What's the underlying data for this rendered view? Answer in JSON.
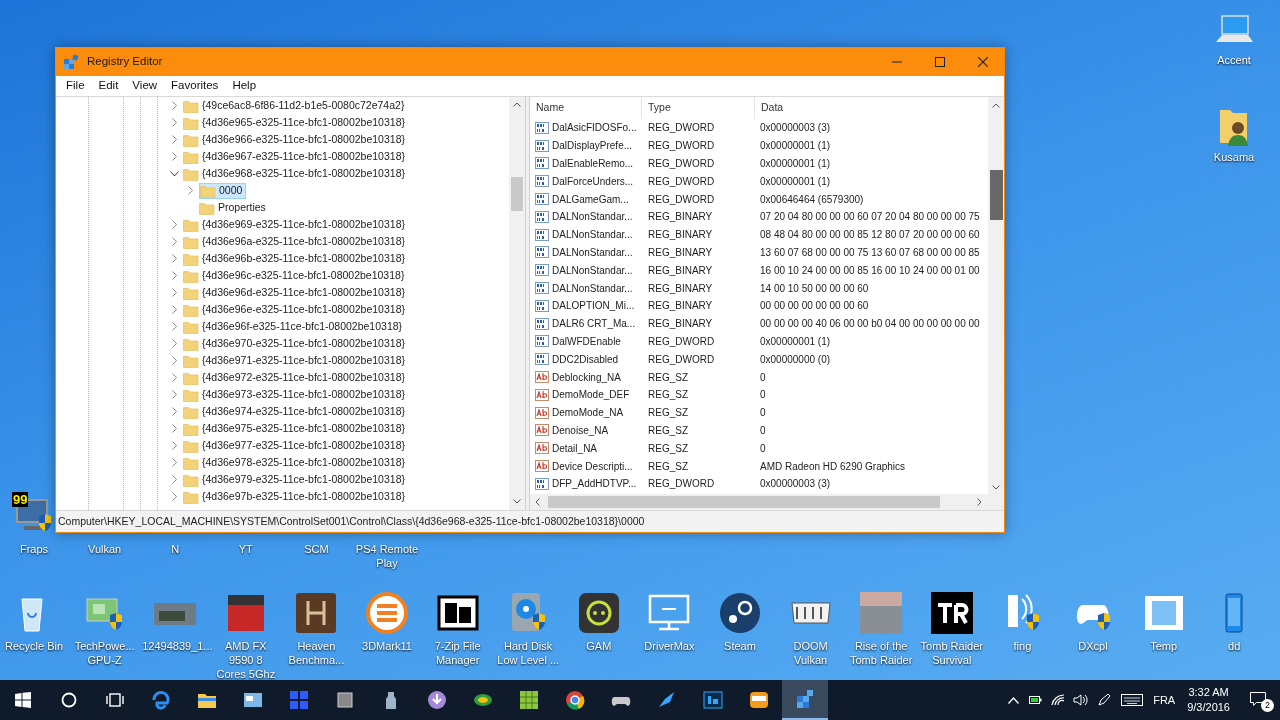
{
  "desktop": {
    "top_right": [
      {
        "label": "Accent"
      },
      {
        "label": "Kusama"
      }
    ],
    "fps_counter": "99",
    "top_row": [
      {
        "label": "Fraps"
      },
      {
        "label": "Vulkan"
      },
      {
        "label": "N"
      },
      {
        "label": "YT"
      },
      {
        "label": "SCM"
      },
      {
        "label": "PS4 Remote Play"
      }
    ],
    "bottom_row": [
      {
        "label": "Recycle Bin"
      },
      {
        "label": "TechPowe... GPU-Z"
      },
      {
        "label": "12494839_1..."
      },
      {
        "label": "AMD FX 9590 8 Cores 5Ghz"
      },
      {
        "label": "Heaven Benchma..."
      },
      {
        "label": "3DMark11"
      },
      {
        "label": "7-Zip File Manager"
      },
      {
        "label": "Hard Disk Low Level ..."
      },
      {
        "label": "GAM"
      },
      {
        "label": "DriverMax"
      },
      {
        "label": "Steam"
      },
      {
        "label": "DOOM Vulkan"
      },
      {
        "label": "Rise of the Tomb Raider"
      },
      {
        "label": "Tomb Raider Survival"
      },
      {
        "label": "fing"
      },
      {
        "label": "DXcpl"
      },
      {
        "label": "Temp"
      },
      {
        "label": "dd"
      }
    ]
  },
  "window": {
    "title": "Registry Editor",
    "menu": [
      "File",
      "Edit",
      "View",
      "Favorites",
      "Help"
    ],
    "tree": [
      {
        "label": "{49ce6ac8-6f86-11d2-b1e5-0080c72e74a2}",
        "expandable": true,
        "expanded": false,
        "selected": false
      },
      {
        "label": "{4d36e965-e325-11ce-bfc1-08002be10318}",
        "expandable": true,
        "expanded": false,
        "selected": false
      },
      {
        "label": "{4d36e966-e325-11ce-bfc1-08002be10318}",
        "expandable": true,
        "expanded": false,
        "selected": false
      },
      {
        "label": "{4d36e967-e325-11ce-bfc1-08002be10318}",
        "expandable": true,
        "expanded": false,
        "selected": false
      },
      {
        "label": "{4d36e968-e325-11ce-bfc1-08002be10318}",
        "expandable": true,
        "expanded": true,
        "selected": false,
        "children": [
          {
            "label": "0000",
            "expandable": true,
            "expanded": false,
            "selected": true
          },
          {
            "label": "Properties",
            "expandable": false,
            "expanded": false,
            "selected": false
          }
        ]
      },
      {
        "label": "{4d36e969-e325-11ce-bfc1-08002be10318}",
        "expandable": true,
        "expanded": false,
        "selected": false
      },
      {
        "label": "{4d36e96a-e325-11ce-bfc1-08002be10318}",
        "expandable": true,
        "expanded": false,
        "selected": false
      },
      {
        "label": "{4d36e96b-e325-11ce-bfc1-08002be10318}",
        "expandable": true,
        "expanded": false,
        "selected": false
      },
      {
        "label": "{4d36e96c-e325-11ce-bfc1-08002be10318}",
        "expandable": true,
        "expanded": false,
        "selected": false
      },
      {
        "label": "{4d36e96d-e325-11ce-bfc1-08002be10318}",
        "expandable": true,
        "expanded": false,
        "selected": false
      },
      {
        "label": "{4d36e96e-e325-11ce-bfc1-08002be10318}",
        "expandable": true,
        "expanded": false,
        "selected": false
      },
      {
        "label": "{4d36e96f-e325-11ce-bfc1-08002be10318}",
        "expandable": true,
        "expanded": false,
        "selected": false
      },
      {
        "label": "{4d36e970-e325-11ce-bfc1-08002be10318}",
        "expandable": true,
        "expanded": false,
        "selected": false
      },
      {
        "label": "{4d36e971-e325-11ce-bfc1-08002be10318}",
        "expandable": true,
        "expanded": false,
        "selected": false
      },
      {
        "label": "{4d36e972-e325-11ce-bfc1-08002be10318}",
        "expandable": true,
        "expanded": false,
        "selected": false
      },
      {
        "label": "{4d36e973-e325-11ce-bfc1-08002be10318}",
        "expandable": true,
        "expanded": false,
        "selected": false
      },
      {
        "label": "{4d36e974-e325-11ce-bfc1-08002be10318}",
        "expandable": true,
        "expanded": false,
        "selected": false
      },
      {
        "label": "{4d36e975-e325-11ce-bfc1-08002be10318}",
        "expandable": true,
        "expanded": false,
        "selected": false
      },
      {
        "label": "{4d36e977-e325-11ce-bfc1-08002be10318}",
        "expandable": true,
        "expanded": false,
        "selected": false
      },
      {
        "label": "{4d36e978-e325-11ce-bfc1-08002be10318}",
        "expandable": true,
        "expanded": false,
        "selected": false
      },
      {
        "label": "{4d36e979-e325-11ce-bfc1-08002be10318}",
        "expandable": true,
        "expanded": false,
        "selected": false
      },
      {
        "label": "{4d36e97b-e325-11ce-bfc1-08002be10318}",
        "expandable": true,
        "expanded": false,
        "selected": false
      }
    ],
    "columns": [
      "Name",
      "Type",
      "Data"
    ],
    "values": [
      {
        "kind": "number",
        "name": "DalAsicFIDOSFo...",
        "type": "REG_DWORD",
        "data": "0x00000003 (3)"
      },
      {
        "kind": "number",
        "name": "DalDisplayPrefe...",
        "type": "REG_DWORD",
        "data": "0x00000001 (1)"
      },
      {
        "kind": "number",
        "name": "DalEnableRemo...",
        "type": "REG_DWORD",
        "data": "0x00000001 (1)"
      },
      {
        "kind": "number",
        "name": "DalForceUnders...",
        "type": "REG_DWORD",
        "data": "0x00000001 (1)"
      },
      {
        "kind": "number",
        "name": "DALGameGam...",
        "type": "REG_DWORD",
        "data": "0x00646464 (6579300)"
      },
      {
        "kind": "number",
        "name": "DALNonStandar...",
        "type": "REG_BINARY",
        "data": "07 20 04 80 00 00 00 60 07 20 04 80 00 00 00 75"
      },
      {
        "kind": "number",
        "name": "DALNonStandar...",
        "type": "REG_BINARY",
        "data": "08 48 04 80 00 00 00 85 12 80 07 20 00 00 00 60"
      },
      {
        "kind": "number",
        "name": "DALNonStandar...",
        "type": "REG_BINARY",
        "data": "13 60 07 68 00 00 00 75 13 60 07 68 00 00 00 85"
      },
      {
        "kind": "number",
        "name": "DALNonStandar...",
        "type": "REG_BINARY",
        "data": "16 00 10 24 00 00 00 85 16 00 10 24 00 00 01 00"
      },
      {
        "kind": "number",
        "name": "DALNonStandar...",
        "type": "REG_BINARY",
        "data": "14 00 10 50 00 00 00 60"
      },
      {
        "kind": "number",
        "name": "DALOPTION_Mi...",
        "type": "REG_BINARY",
        "data": "00 00 00 00 00 00 00 60"
      },
      {
        "kind": "number",
        "name": "DALR6 CRT_Ma...",
        "type": "REG_BINARY",
        "data": "00 00 00 00 40 06 00 00 b0 04 00 00 00 00 00 00"
      },
      {
        "kind": "number",
        "name": "DalWFDEnable",
        "type": "REG_DWORD",
        "data": "0x00000001 (1)"
      },
      {
        "kind": "number",
        "name": "DDC2Disabled",
        "type": "REG_DWORD",
        "data": "0x00000000 (0)"
      },
      {
        "kind": "text",
        "name": "Deblocking_NA",
        "type": "REG_SZ",
        "data": "0"
      },
      {
        "kind": "text",
        "name": "DemoMode_DEF",
        "type": "REG_SZ",
        "data": "0"
      },
      {
        "kind": "text",
        "name": "DemoMode_NA",
        "type": "REG_SZ",
        "data": "0"
      },
      {
        "kind": "text",
        "name": "Denoise_NA",
        "type": "REG_SZ",
        "data": "0"
      },
      {
        "kind": "text",
        "name": "Detail_NA",
        "type": "REG_SZ",
        "data": "0"
      },
      {
        "kind": "text",
        "name": "Device Descripti...",
        "type": "REG_SZ",
        "data": "AMD Radeon HD 6290 Graphics"
      },
      {
        "kind": "number",
        "name": "DFP_AddHDTVP...",
        "type": "REG_DWORD",
        "data": "0x00000003 (3)"
      }
    ],
    "status_bar": "Computer\\HKEY_LOCAL_MACHINE\\SYSTEM\\ControlSet001\\Control\\Class\\{4d36e968-e325-11ce-bfc1-08002be10318}\\0000"
  },
  "taskbar": {
    "apps": [
      {
        "active": false
      },
      {
        "active": false
      },
      {
        "active": false
      },
      {
        "active": false
      },
      {
        "active": false
      },
      {
        "active": false
      },
      {
        "active": false
      },
      {
        "active": false
      },
      {
        "active": false
      },
      {
        "active": false
      },
      {
        "active": false
      },
      {
        "active": false
      },
      {
        "active": false
      },
      {
        "active": false
      },
      {
        "active": true
      }
    ],
    "language": "FRA",
    "time": "3:32 AM",
    "date": "9/3/2016",
    "notifications": "2"
  }
}
